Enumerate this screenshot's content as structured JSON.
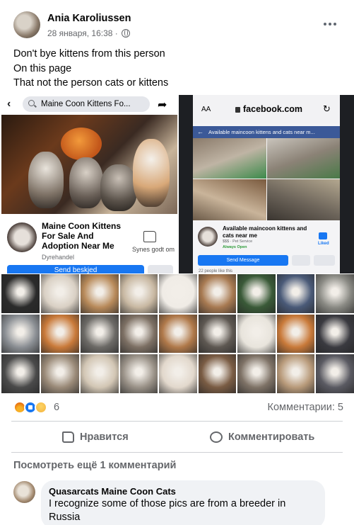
{
  "post": {
    "author": "Ania Karoliussen",
    "date": "28 января, 16:38 ·",
    "text_lines": [
      "Don't bye kittens from this person",
      "On this page",
      "That not the person cats or kittens"
    ]
  },
  "left_screenshot": {
    "search_text": "Maine  Coon Kittens Fo...",
    "page_name": "Maine  Coon Kittens For Sale And Adoption Near Me",
    "page_category": "Dyrehandel",
    "like_label": "Synes godt om",
    "send_label": "Send beskjed"
  },
  "right_screenshot": {
    "aa": "AA",
    "url": "facebook.com",
    "header_text": "Available maincoon kittens and cats near m...",
    "page_name": "Available maincoon kittens and cats near me",
    "sub_text": "$$$ · Pet Service",
    "open_text": "Always Open",
    "liked_label": "Liked",
    "send_label": "Send Message",
    "likes_text": "22 people like this"
  },
  "reactions": {
    "count": "6",
    "types": [
      "angry-icon",
      "like-icon",
      "sad-icon"
    ]
  },
  "comments_count": "Комментарии: 5",
  "actions": {
    "like_label": "Нравится",
    "comment_label": "Комментировать"
  },
  "view_more": "Посмотреть ещё 1 комментарий",
  "comment": {
    "author": "Quasarcats Maine Coon Cats",
    "text": "I recognize some of those pics are from a breeder in Russia"
  },
  "colors": {
    "accent": "#1877f2",
    "secondary_text": "#65676b",
    "bubble": "#f0f2f5",
    "divider": "#ced0d4"
  }
}
